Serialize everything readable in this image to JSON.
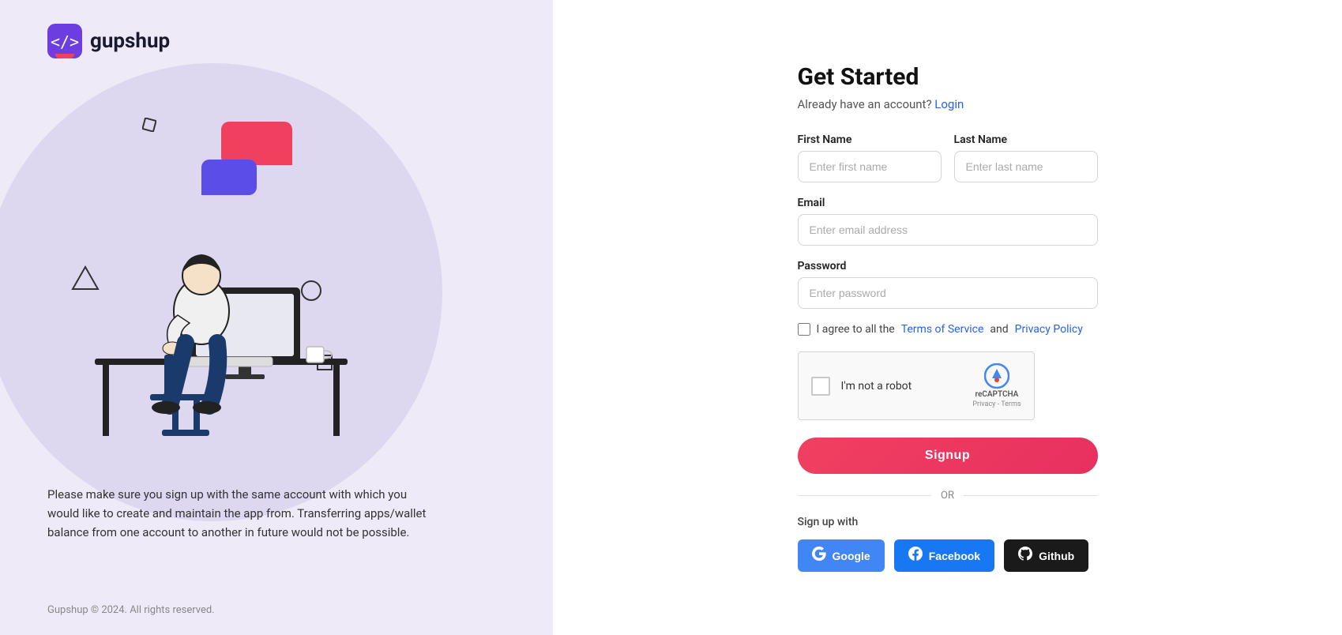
{
  "logo": {
    "text": "gupshup"
  },
  "left": {
    "description": "Please make sure you sign up with the same account with which you would like to create and maintain the app from. Transferring apps/wallet balance from one account to another in future would not be possible.",
    "copyright": "Gupshup © 2024. All rights reserved."
  },
  "form": {
    "title": "Get Started",
    "login_prompt": "Already have an account?",
    "login_link": "Login",
    "first_name_label": "First Name",
    "first_name_placeholder": "Enter first name",
    "last_name_label": "Last Name",
    "last_name_placeholder": "Enter last name",
    "email_label": "Email",
    "email_placeholder": "Enter email address",
    "password_label": "Password",
    "password_placeholder": "Enter password",
    "terms_text": "I agree to all the",
    "terms_link": "Terms of Service",
    "and_text": "and",
    "privacy_link": "Privacy Policy",
    "recaptcha_label": "I'm not a robot",
    "recaptcha_brand": "reCAPTCHA",
    "recaptcha_terms": "Privacy - Terms",
    "signup_btn": "Signup",
    "or_text": "OR",
    "sign_up_with": "Sign up with",
    "google_btn": "Google",
    "facebook_btn": "Facebook",
    "github_btn": "Github"
  }
}
